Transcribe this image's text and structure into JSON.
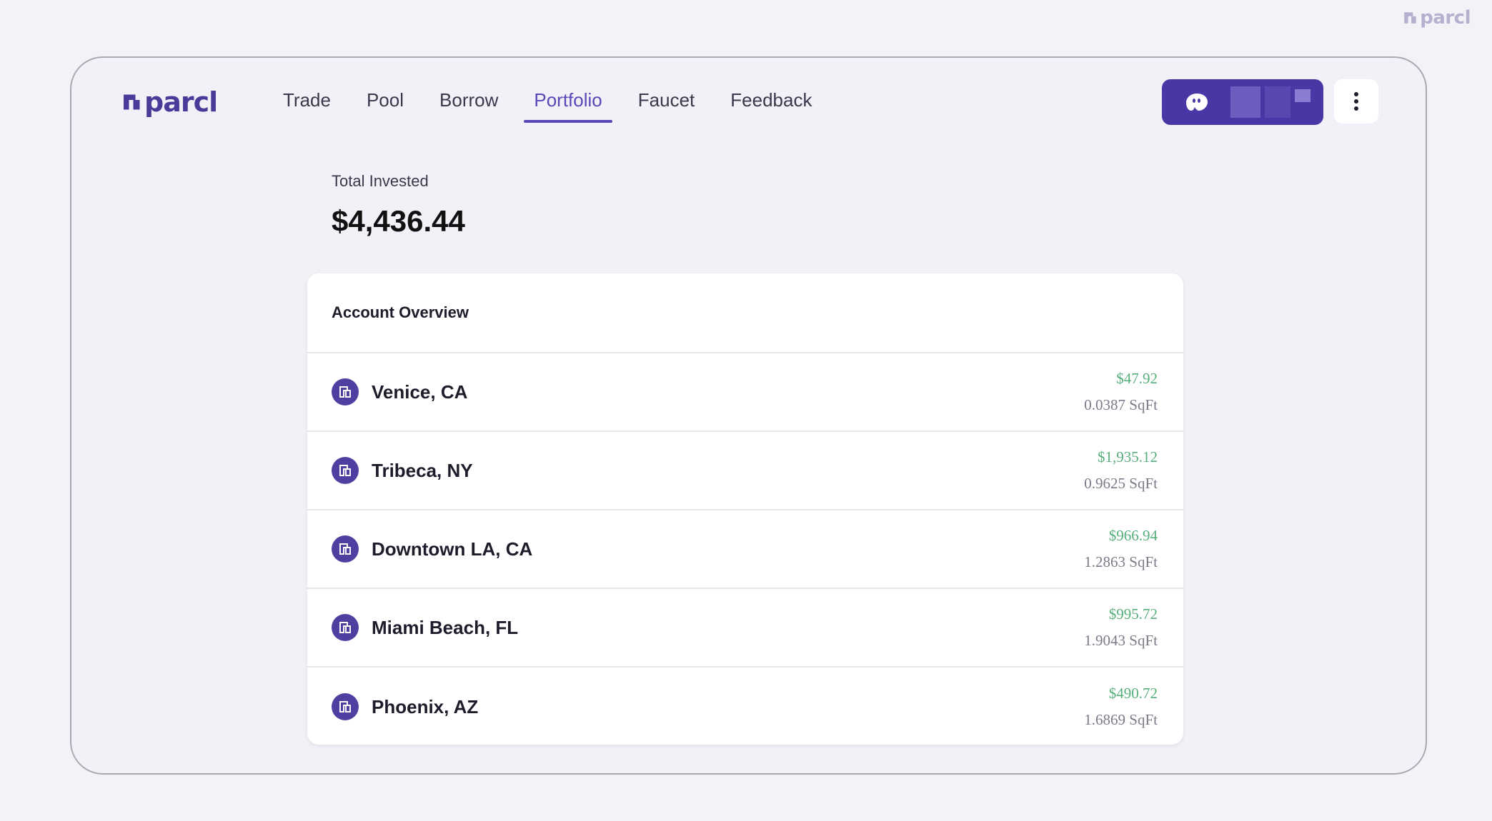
{
  "corner_logo": "parcl",
  "header": {
    "brand": "parcl",
    "nav": [
      {
        "label": "Trade"
      },
      {
        "label": "Pool"
      },
      {
        "label": "Borrow"
      },
      {
        "label": "Portfolio",
        "active": true
      },
      {
        "label": "Faucet"
      },
      {
        "label": "Feedback"
      }
    ],
    "wallet_icon": "ghost-wallet-icon",
    "menu_icon": "more-vertical-icon"
  },
  "summary": {
    "total_label": "Total Invested",
    "total_value": "$4,436.44"
  },
  "account": {
    "title": "Account Overview",
    "rows": [
      {
        "location": "Venice, CA",
        "value": "$47.92",
        "sqft": "0.0387 SqFt"
      },
      {
        "location": "Tribeca, NY",
        "value": "$1,935.12",
        "sqft": "0.9625 SqFt"
      },
      {
        "location": "Downtown LA, CA",
        "value": "$966.94",
        "sqft": "1.2863 SqFt"
      },
      {
        "location": "Miami Beach, FL",
        "value": "$995.72",
        "sqft": "1.9043 SqFt"
      },
      {
        "location": "Phoenix, AZ",
        "value": "$490.72",
        "sqft": "1.6869 SqFt"
      }
    ]
  },
  "colors": {
    "accent": "#4a37a5",
    "positive": "#57b07b",
    "muted": "#7c7a88"
  }
}
